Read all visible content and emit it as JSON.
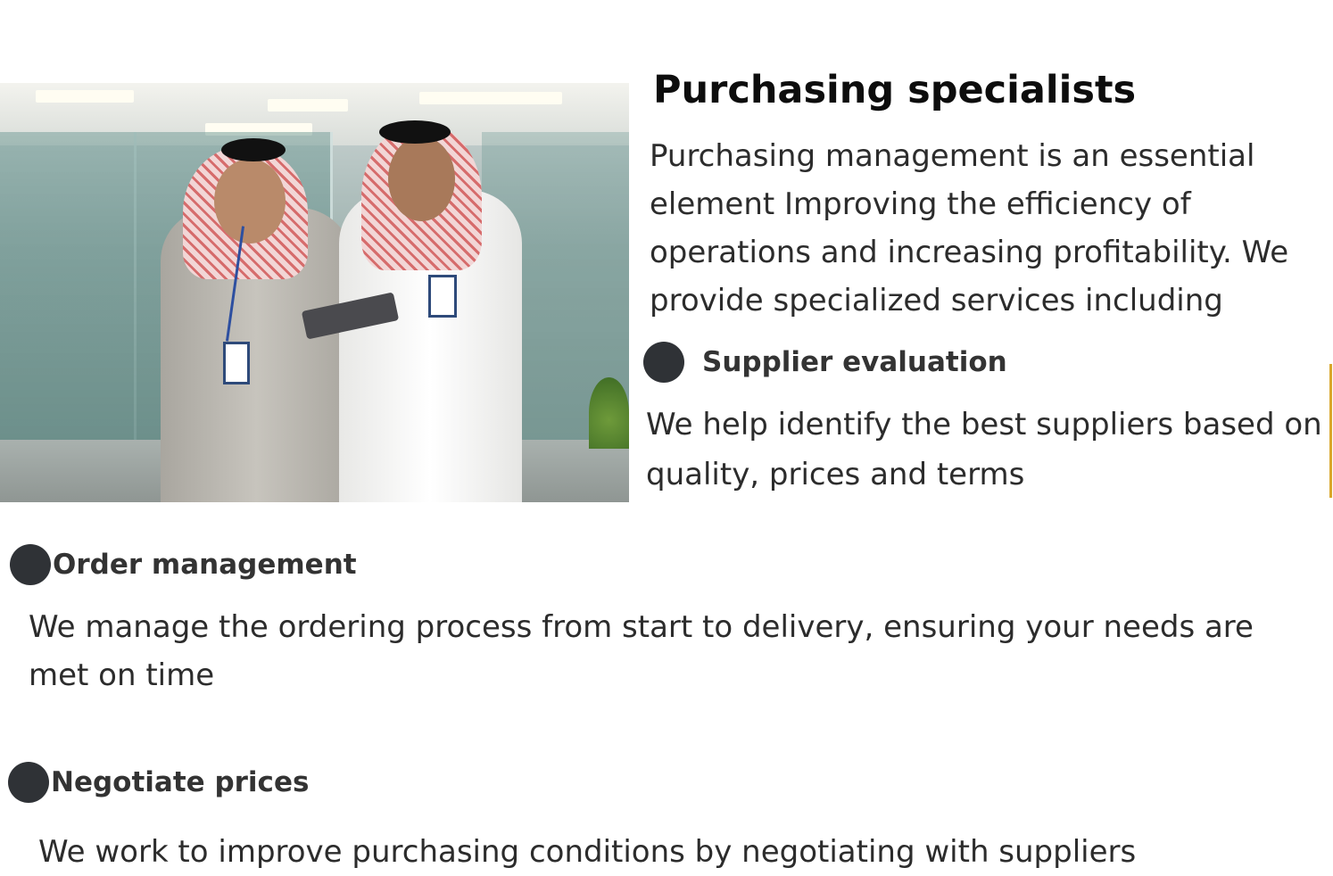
{
  "hero_image": {
    "alt": "Two colleagues in traditional dress reviewing a tablet in an office corridor",
    "colors": {
      "glass": "#8ea5a1",
      "robe_grey": "#b7b4ad",
      "robe_white": "#f4f4f2",
      "ghutra_red": "#d66c6c"
    }
  },
  "section": {
    "title": "Purchasing specialists",
    "intro": "Purchasing management is an essential element Improving the efficiency of operations and increasing profitability. We provide specialized services including"
  },
  "features": [
    {
      "icon": "bullet-dot-icon",
      "heading": "Supplier evaluation",
      "text": "We help identify the best suppliers based on quality, prices and terms"
    },
    {
      "icon": "bullet-dot-icon",
      "heading": "Order management",
      "text": "We manage the ordering process from start to delivery, ensuring your needs are met on time"
    },
    {
      "icon": "bullet-dot-icon",
      "heading": "Negotiate prices",
      "text": "We work to improve purchasing conditions by negotiating with suppliers"
    }
  ],
  "colors": {
    "bullet": "#2f3236",
    "accent_rule": "#d9a62a",
    "title": "#0d0d0d",
    "body_text": "#2c2c2c"
  }
}
